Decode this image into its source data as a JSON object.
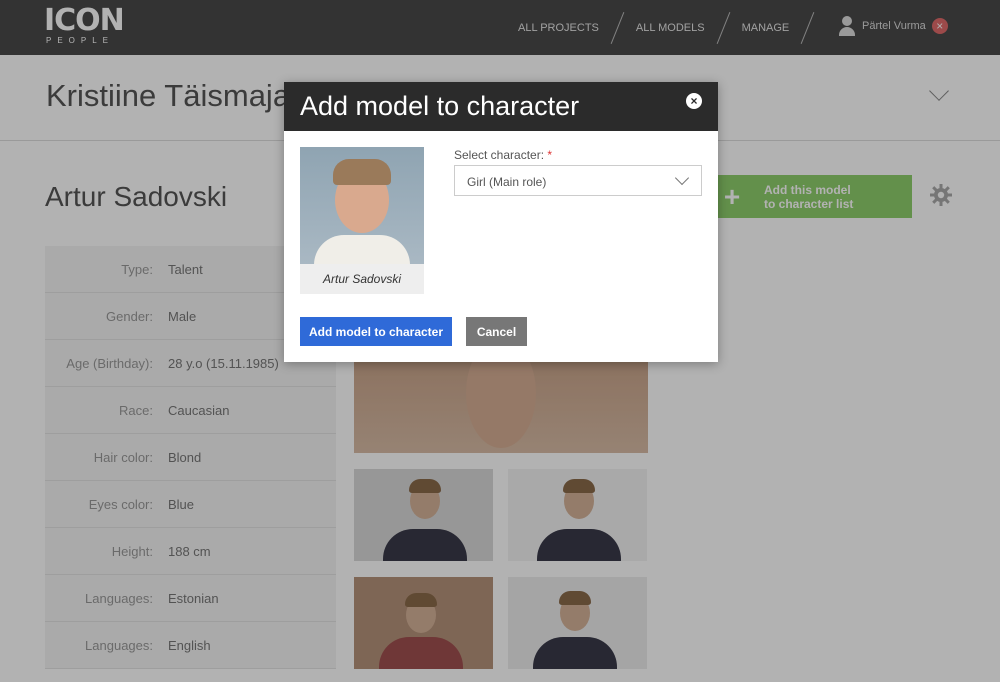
{
  "logo": {
    "main": "ICON",
    "sub": "PEOPLE"
  },
  "nav": {
    "items": [
      {
        "label": "ALL PROJECTS"
      },
      {
        "label": "ALL MODELS"
      },
      {
        "label": "MANAGE"
      }
    ]
  },
  "user": {
    "name": "Pärtel Vurma",
    "logout_glyph": "×"
  },
  "project": {
    "title": "Kristiine Täismaja"
  },
  "model": {
    "name": "Artur Sadovski",
    "add_button": {
      "icon": "+",
      "line1": "Add this model",
      "line2": "to character list"
    },
    "attributes": [
      {
        "label": "Type:",
        "value": "Talent"
      },
      {
        "label": "Gender:",
        "value": "Male"
      },
      {
        "label": "Age (Birthday):",
        "value": "28 y.o (15.11.1985)"
      },
      {
        "label": "Race:",
        "value": "Caucasian"
      },
      {
        "label": "Hair color:",
        "value": "Blond"
      },
      {
        "label": "Eyes color:",
        "value": "Blue"
      },
      {
        "label": "Height:",
        "value": "188 cm"
      },
      {
        "label": "Languages:",
        "value": "Estonian"
      },
      {
        "label": "Languages:",
        "value": "English"
      }
    ]
  },
  "dialog": {
    "title": "Add model to character",
    "close_glyph": "×",
    "model_card_name": "Artur Sadovski",
    "select_label": "Select character:",
    "required_mark": "*",
    "select_value": "Girl (Main role)",
    "confirm_label": "Add model to character",
    "cancel_label": "Cancel"
  },
  "colors": {
    "topbar": "#4a4a4a",
    "primary": "#2f6ad8",
    "add_green": "#8fce6c",
    "dialog_header": "#2b2b2b"
  }
}
